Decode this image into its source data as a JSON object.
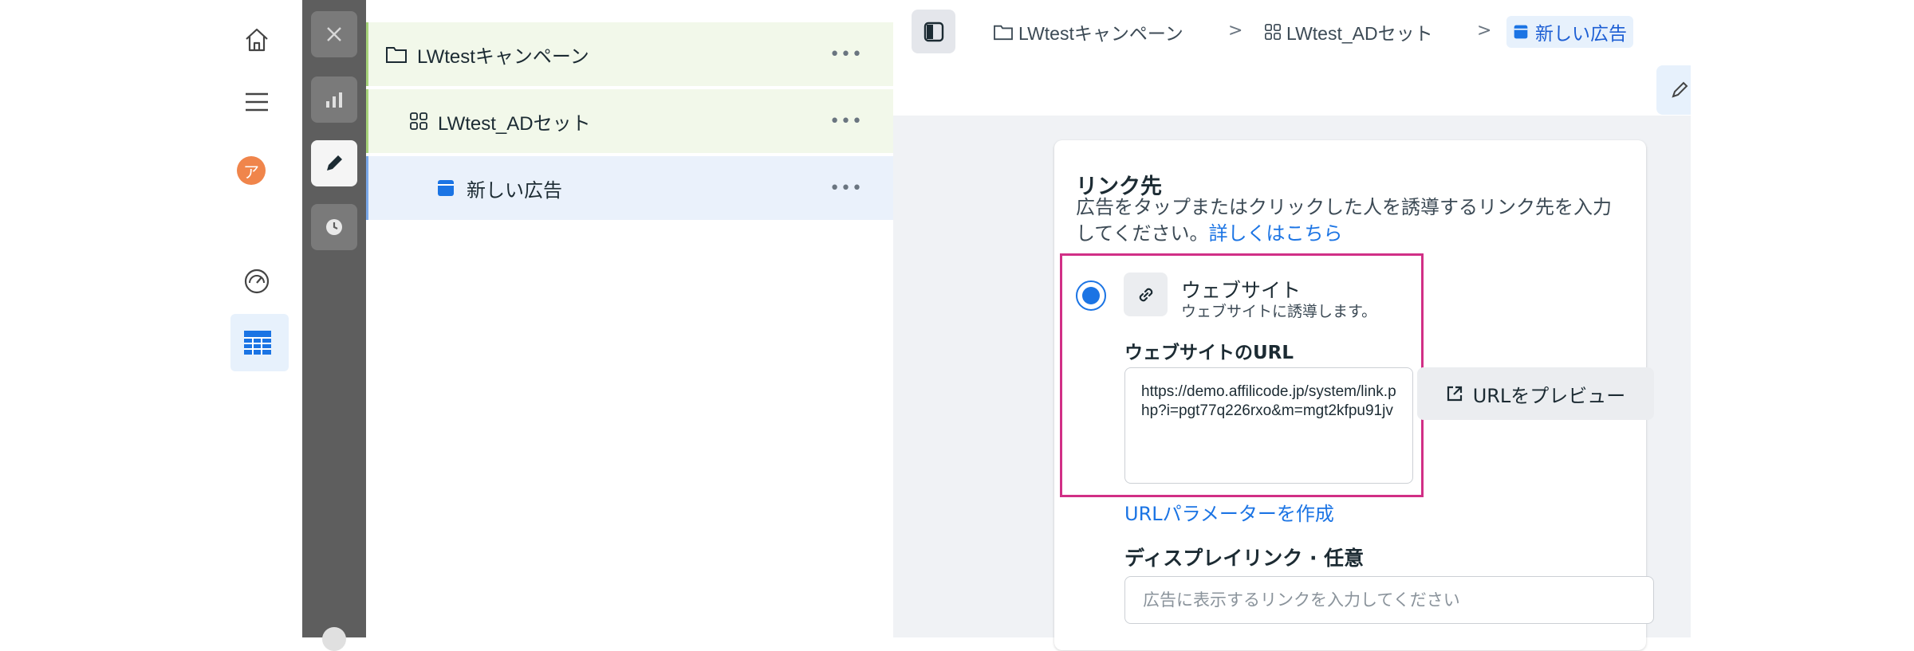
{
  "nav": {
    "avatar_letter": "ア",
    "icons": [
      "home-icon",
      "menu-icon",
      "dashboard-gauge-icon",
      "table-icon"
    ]
  },
  "rail": {
    "icons": [
      "close-icon",
      "chart-icon",
      "edit-icon",
      "history-icon"
    ]
  },
  "tree": {
    "campaign_label": "LWtestキャンペーン",
    "adset_label": "LWtest_ADセット",
    "ad_label": "新しい広告",
    "more": "•••"
  },
  "breadcrumb": {
    "campaign": "LWtestキャンペーン",
    "adset": "LWtest_ADセット",
    "ad": "新しい広告",
    "separator": ">"
  },
  "destination": {
    "title": "リンク先",
    "description": "広告をタップまたはクリックした人を誘導するリンク先を入力",
    "description_line2": "してください。",
    "learn_more": "詳しくはこちら",
    "option_title": "ウェブサイト",
    "option_subtitle": "ウェブサイトに誘導します。",
    "url_label": "ウェブサイトのURL",
    "url_value": "https://demo.affilicode.jp/system/link.php?i=pgt77q226rxo&m=mgt2kfpu91jv",
    "preview_button": "URLをプレビュー",
    "build_params_link": "URLパラメーターを作成",
    "display_link_label": "ディスプレイリンク · 任意",
    "display_link_placeholder": "広告に表示するリンクを入力してください"
  },
  "colors": {
    "accent": "#1b74e4",
    "highlight_border": "#d12f86",
    "avatar": "#f0854b",
    "rail": "#5e5e5e"
  }
}
